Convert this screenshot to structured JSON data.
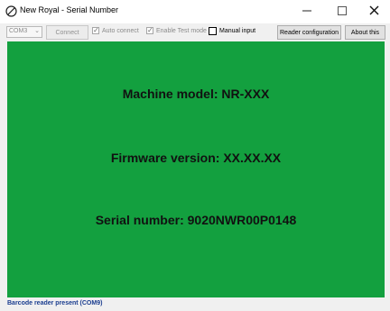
{
  "window": {
    "title": "New Royal - Serial Number",
    "icons": {
      "app": "no-entry-icon",
      "minimize": "minimize-icon",
      "maximize": "maximize-icon",
      "close": "close-icon"
    }
  },
  "toolbar": {
    "port_select": {
      "value": "COM3",
      "arrow": "chevron-down-icon"
    },
    "connect_label": "Connect",
    "auto_connect": {
      "label": "Auto connect",
      "checked": true
    },
    "test_mode": {
      "label": "Enable Test mode",
      "checked": true
    },
    "manual_input": {
      "label": "Manual input",
      "checked": false
    },
    "reader_config_label": "Reader configuration",
    "about_label": "About this"
  },
  "main": {
    "background": "#13a03f",
    "machine_model": "Machine model: NR-XXX",
    "firmware_version": "Firmware version: XX.XX.XX",
    "serial_number": "Serial number: 9020NWR00P0148"
  },
  "status_bar": {
    "text": "Barcode reader present (COM9)",
    "color": "#1a3d8f"
  }
}
